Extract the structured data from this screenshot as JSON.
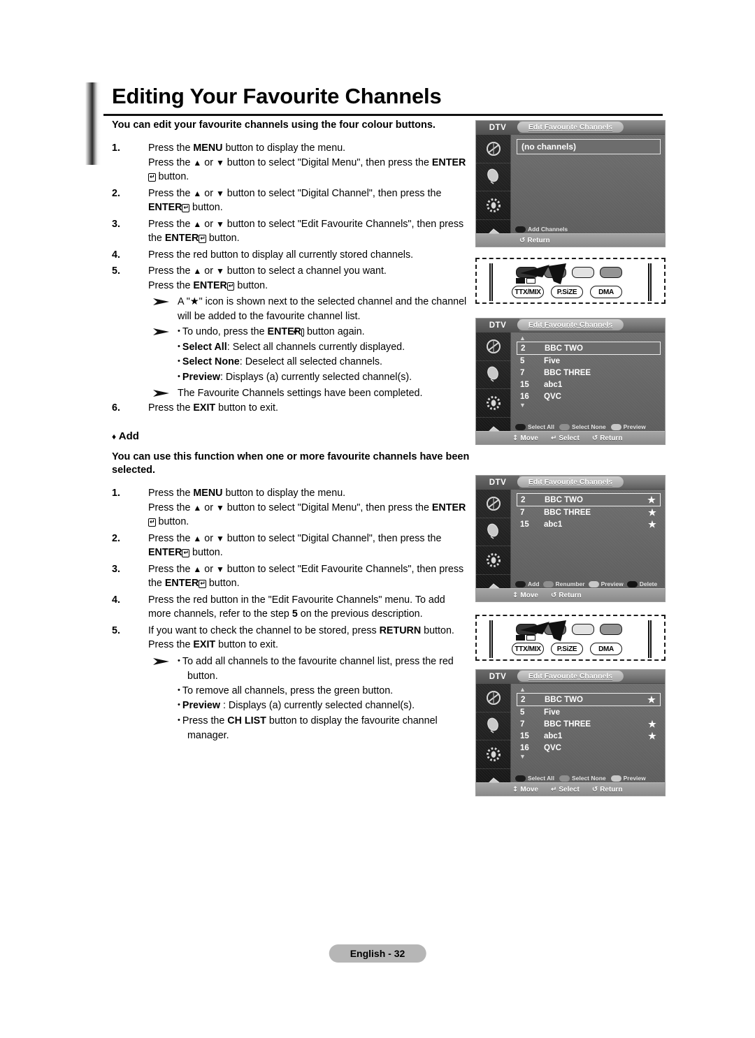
{
  "page": {
    "title": "Editing Your Favourite Channels",
    "footer_label": "English - 32"
  },
  "section1": {
    "lead": "You can edit your favourite channels using the four colour buttons.",
    "steps": [
      {
        "num": "1.",
        "lines": [
          "Press the MENU button to display the menu.",
          "Press the ▲ or ▼ button to select \"Digital Menu\", then press the ENTER↵ button."
        ]
      },
      {
        "num": "2.",
        "lines": [
          "Press the ▲ or ▼ button to select \"Digital Channel\", then press the ENTER↵ button."
        ]
      },
      {
        "num": "3.",
        "lines": [
          "Press the ▲ or ▼ button to select \"Edit Favourite Channels\", then press the ENTER↵ button."
        ]
      },
      {
        "num": "4.",
        "lines": [
          "Press the red button to display all currently stored channels."
        ]
      },
      {
        "num": "5.",
        "lines": [
          "Press the ▲ or ▼ button to select a channel you want.",
          "Press the ENTER↵ button."
        ]
      }
    ],
    "note_star": "A \"★\" icon is shown next to the selected channel and the channel will be added to the favourite channel list.",
    "note_undo": "To undo, press the ENTER↵ button again.",
    "bullets": [
      {
        "term": "Select All",
        "desc": ": Select all channels currently displayed."
      },
      {
        "term": "Select None",
        "desc": ": Deselect all selected channels."
      },
      {
        "term": "Preview",
        "desc": ": Displays (a) currently selected channel(s)."
      }
    ],
    "note_completed": "The Favourite Channels settings have been completed.",
    "step6": {
      "num": "6.",
      "line": "Press the EXIT button to exit."
    }
  },
  "section2": {
    "heading": "Add",
    "heading_marker": "♦",
    "lead": "You can use this function when one or more favourite channels have been selected.",
    "steps": [
      {
        "num": "1.",
        "lines": [
          "Press the MENU button to display the menu.",
          "Press the ▲ or ▼ button to select \"Digital Menu\", then press the ENTER↵ button."
        ]
      },
      {
        "num": "2.",
        "lines": [
          "Press the ▲ or ▼ button to select \"Digital Channel\", then press the ENTER↵ button."
        ]
      },
      {
        "num": "3.",
        "lines": [
          "Press the ▲ or ▼ button to select \"Edit Favourite Channels\", then press the ENTER↵ button."
        ]
      },
      {
        "num": "4.",
        "lines": [
          "Press the red button in the \"Edit Favourite Channels\" menu. To add more channels, refer to the step 5 on the previous description."
        ]
      },
      {
        "num": "5.",
        "lines": [
          "If you want to check the channel to be stored, press RETURN button.",
          "Press the EXIT button to exit."
        ]
      }
    ],
    "bullets": [
      {
        "term": "",
        "desc": "To add all channels to the favourite channel list, press the red button."
      },
      {
        "term": "",
        "desc": "To remove all channels, press the green button."
      },
      {
        "term": "Preview",
        "desc": " : Displays (a) currently selected channel(s)."
      },
      {
        "term": "",
        "desc": "Press the CH LIST button to display the favourite channel manager."
      }
    ]
  },
  "tv_screens": [
    {
      "id": "screen-no-channels",
      "source_label": "DTV",
      "menu_title": "Edit Favourite Channels",
      "empty_text": "(no channels)",
      "channels": [],
      "color_keys": [
        {
          "color": "red",
          "label": "Add Channels"
        }
      ],
      "footer": [
        {
          "glyph": "↺",
          "label": "Return"
        }
      ],
      "scroll_up": false,
      "scroll_down": false
    },
    {
      "id": "screen-all-channels",
      "source_label": "DTV",
      "menu_title": "Edit Favourite Channels",
      "empty_text": "",
      "channels": [
        {
          "number": "2",
          "name": "BBC TWO",
          "star": "",
          "selected": true
        },
        {
          "number": "5",
          "name": "Five",
          "star": "",
          "selected": false
        },
        {
          "number": "7",
          "name": "BBC THREE",
          "star": "",
          "selected": false
        },
        {
          "number": "15",
          "name": "abc1",
          "star": "",
          "selected": false
        },
        {
          "number": "16",
          "name": "QVC",
          "star": "",
          "selected": false
        }
      ],
      "color_keys": [
        {
          "color": "red",
          "label": "Select All"
        },
        {
          "color": "green",
          "label": "Select None"
        },
        {
          "color": "yellow",
          "label": "Preview"
        }
      ],
      "footer": [
        {
          "glyph": "↕",
          "label": "Move"
        },
        {
          "glyph": "↵",
          "label": "Select"
        },
        {
          "glyph": "↺",
          "label": "Return"
        }
      ],
      "scroll_up": true,
      "scroll_down": true
    },
    {
      "id": "screen-favourites",
      "source_label": "DTV",
      "menu_title": "Edit Favourite Channels",
      "empty_text": "",
      "channels": [
        {
          "number": "2",
          "name": "BBC TWO",
          "star": "★",
          "selected": true
        },
        {
          "number": "7",
          "name": "BBC THREE",
          "star": "★",
          "selected": false
        },
        {
          "number": "15",
          "name": "abc1",
          "star": "★",
          "selected": false
        }
      ],
      "color_keys": [
        {
          "color": "red",
          "label": "Add"
        },
        {
          "color": "green",
          "label": "Renumber"
        },
        {
          "color": "yellow",
          "label": "Preview"
        },
        {
          "color": "blue",
          "label": "Delete"
        }
      ],
      "footer": [
        {
          "glyph": "↕",
          "label": "Move"
        },
        {
          "glyph": "↺",
          "label": "Return"
        }
      ],
      "scroll_up": false,
      "scroll_down": false
    },
    {
      "id": "screen-all-channels-starred",
      "source_label": "DTV",
      "menu_title": "Edit Favourite Channels",
      "empty_text": "",
      "channels": [
        {
          "number": "2",
          "name": "BBC TWO",
          "star": "★",
          "selected": true
        },
        {
          "number": "5",
          "name": "Five",
          "star": "",
          "selected": false
        },
        {
          "number": "7",
          "name": "BBC THREE",
          "star": "★",
          "selected": false
        },
        {
          "number": "15",
          "name": "abc1",
          "star": "★",
          "selected": false
        },
        {
          "number": "16",
          "name": "QVC",
          "star": "",
          "selected": false
        }
      ],
      "color_keys": [
        {
          "color": "red",
          "label": "Select All"
        },
        {
          "color": "green",
          "label": "Select None"
        },
        {
          "color": "yellow",
          "label": "Preview"
        }
      ],
      "footer": [
        {
          "glyph": "↕",
          "label": "Move"
        },
        {
          "glyph": "↵",
          "label": "Select"
        },
        {
          "glyph": "↺",
          "label": "Return"
        }
      ],
      "scroll_up": true,
      "scroll_down": true
    }
  ],
  "remote_diagrams": [
    {
      "id": "remote-colour-buttons-1",
      "buttons": [
        "TTX/MIX",
        "P.SiZE",
        "DMA"
      ],
      "colour_keys": [
        "red",
        "green",
        "yellow",
        "blue"
      ]
    },
    {
      "id": "remote-colour-buttons-2",
      "buttons": [
        "TTX/MIX",
        "P.SiZE",
        "DMA"
      ],
      "colour_keys": [
        "red",
        "green",
        "yellow",
        "blue"
      ]
    }
  ]
}
